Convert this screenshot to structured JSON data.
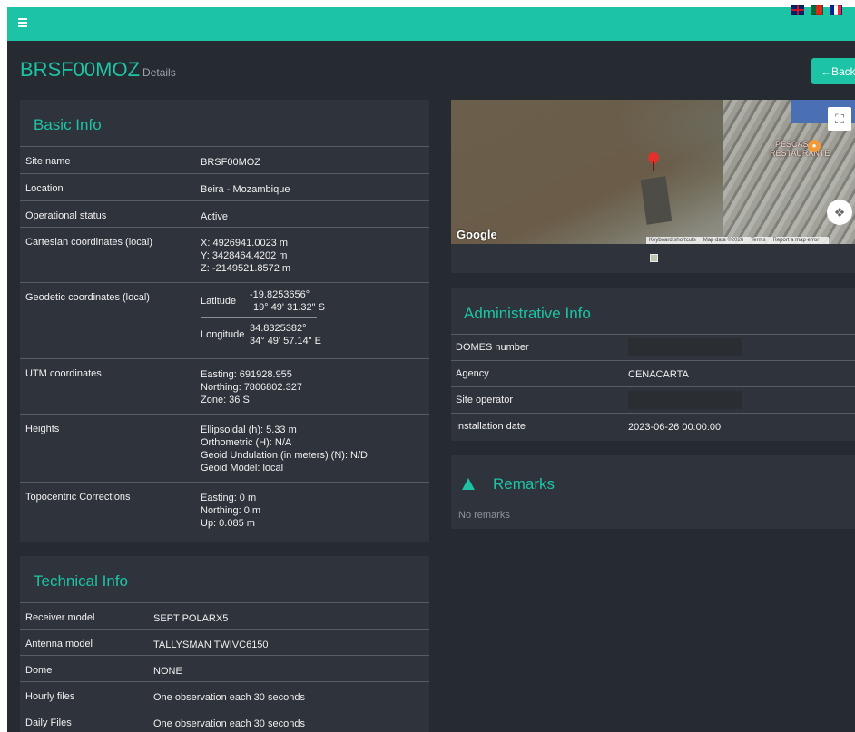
{
  "header": {
    "flags": [
      "uk-flag-icon",
      "pt-flag-icon",
      "fr-flag-icon"
    ]
  },
  "page": {
    "title": "BRSF00MOZ",
    "subtitle": "Details",
    "back_label": "←Back"
  },
  "basic_info": {
    "heading": "Basic Info",
    "site_name_label": "Site name",
    "site_name": "BRSF00MOZ",
    "location_label": "Location",
    "location": "Beira - Mozambique",
    "status_label": "Operational status",
    "status": "Active",
    "cartesian_label": "Cartesian coordinates (local)",
    "cart_x": "X: 4926941.0023 m",
    "cart_y": "Y: 3428464.4202 m",
    "cart_z": "Z: -2149521.8572 m",
    "geodetic_label": "Geodetic coordinates (local)",
    "lat_label": "Latitude",
    "lat_dec": "-19.8253656°",
    "lat_dms": "19° 49' 31.32\" S",
    "lon_label": "Longitude",
    "lon_dec": "34.8325382°",
    "lon_dms": "34° 49' 57.14\" E",
    "utm_label": "UTM coordinates",
    "utm_easting": "Easting: 691928.955",
    "utm_northing": "Northing: 7806802.327",
    "utm_zone": "Zone: 36 S",
    "heights_label": "Heights",
    "h_ellipsoidal": "Ellipsoidal (h): 5.33 m",
    "h_orthometric": "Orthometric (H): N/A",
    "h_undulation": "Geoid Undulation (in meters) (N): N/D",
    "h_model": "Geoid Model: local",
    "topo_label": "Topocentric Corrections",
    "topo_easting": "Easting: 0 m",
    "topo_northing": "Northing: 0 m",
    "topo_up": "Up: 0.085 m"
  },
  "technical_info": {
    "heading": "Technical Info",
    "receiver_label": "Receiver model",
    "receiver": "SEPT POLARX5",
    "antenna_label": "Antenna model",
    "antenna": "TALLYSMAN TWIVC6150",
    "dome_label": "Dome",
    "dome": "NONE",
    "hourly_label": "Hourly files",
    "hourly": "One observation each 30 seconds",
    "daily_label": "Daily Files",
    "daily": "One observation each 30 seconds"
  },
  "map": {
    "poi_line1": "PESCAS",
    "poi_line2": "RESTAURANTE",
    "google": "Google",
    "attribution": [
      "Keyboard shortcuts",
      "Map data ©2026",
      "Terms",
      "Report a map error"
    ]
  },
  "admin_info": {
    "heading": "Administrative Info",
    "domes_label": "DOMES number",
    "agency_label": "Agency",
    "agency": "CENACARTA",
    "operator_label": "Site operator",
    "install_label": "Installation date",
    "install": "2023-06-26 00:00:00"
  },
  "remarks": {
    "heading": "Remarks",
    "empty_text": "No remarks"
  },
  "colors": {
    "accent": "#1cc4a5",
    "background": "#262a31",
    "card": "#2f333b"
  }
}
